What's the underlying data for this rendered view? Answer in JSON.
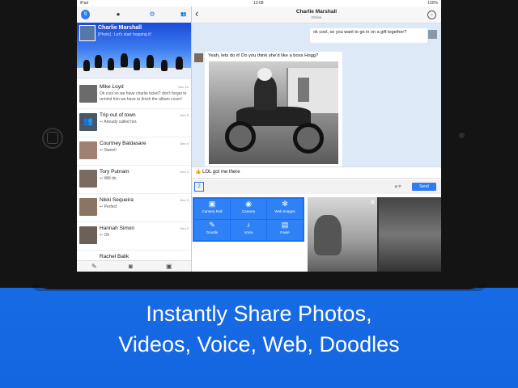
{
  "status": {
    "carrier": "iPad",
    "time": "13:08",
    "battery": "100%"
  },
  "sidebar": {
    "tabs": [
      {
        "label": "9"
      },
      {
        "label": "●"
      },
      {
        "label": "⚙"
      },
      {
        "label": "👥"
      }
    ],
    "hero": {
      "name": "Charlie Marshall",
      "preview": "[Photo] : Let's start hopping it!"
    },
    "items": [
      {
        "name": "Mike Loyd",
        "time": "Dec 14",
        "preview": "Ok cool so we have charlie ticket? don't forget to remind him we have to finish the album cover!"
      },
      {
        "name": "Trip out of town",
        "time": "Dec 8",
        "preview": "↩ Already called her."
      },
      {
        "name": "Courtney Baldasare",
        "time": "Dec 4",
        "preview": "↩ Sweet!"
      },
      {
        "name": "Tory Putnam",
        "time": "Dec 3",
        "preview": "↩ Will do"
      },
      {
        "name": "Nikki Sequeira",
        "time": "Dec 3",
        "preview": "↩ Perfect"
      },
      {
        "name": "Hannah Simon",
        "time": "Dec 3",
        "preview": "↩ Ok"
      },
      {
        "name": "Rachel Balik",
        "time": "",
        "preview": ""
      }
    ],
    "bottom_icons": [
      "compose-icon",
      "camera-icon",
      "gallery-icon"
    ]
  },
  "conversation": {
    "title": "Charlie Marshall",
    "status": "Online",
    "message_right": "ok cool, so you want to go in on a gift together?",
    "message_left": "Yeah, lets do it! Do you think she'd like a boss Hogg?",
    "input_text": "👍 LOL got me there",
    "attachment_count": "2",
    "send_label": "Send"
  },
  "actions": [
    {
      "label": "Camera Roll",
      "icon": "▣"
    },
    {
      "label": "Camera",
      "icon": "◉"
    },
    {
      "label": "Web Images",
      "icon": "✻"
    },
    {
      "label": "Doodle",
      "icon": "✎"
    },
    {
      "label": "Voice",
      "icon": "♪"
    },
    {
      "label": "Paste",
      "icon": "▤"
    }
  ],
  "caption": {
    "line1": "Instantly Share Photos,",
    "line2": "Videos, Voice, Web, Doodles"
  },
  "colors": {
    "background": "#1a6ee6",
    "accent": "#2f7cf0"
  }
}
